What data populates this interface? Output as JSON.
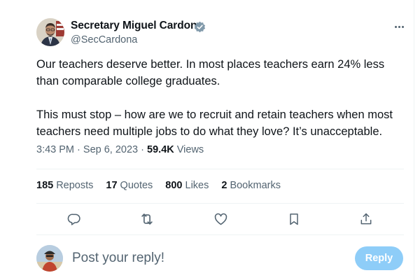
{
  "author": {
    "name": "Secretary Miguel Cardona",
    "handle": "@SecCardona",
    "verified_color": "#829aab"
  },
  "tweet": {
    "paragraphs": [
      "Our teachers deserve better. In most places teachers earn 24% less than comparable college graduates.",
      "This must stop – how are we to recruit and retain teachers when most teachers need multiple jobs to do what they love? It’s unacceptable."
    ],
    "time": "3:43 PM",
    "separator": "·",
    "date": "Sep 6, 2023",
    "views_count": "59.4K",
    "views_label": "Views"
  },
  "stats": {
    "reposts": {
      "count": "185",
      "label": "Reposts"
    },
    "quotes": {
      "count": "17",
      "label": "Quotes"
    },
    "likes": {
      "count": "800",
      "label": "Likes"
    },
    "bookmarks": {
      "count": "2",
      "label": "Bookmarks"
    }
  },
  "actions": [
    "reply-icon",
    "repost-icon",
    "like-icon",
    "bookmark-icon",
    "share-icon"
  ],
  "reply_box": {
    "placeholder": "Post your reply!",
    "button_label": "Reply",
    "button_color": "#8ecdf8"
  },
  "colors": {
    "text": "#0f1419",
    "secondary": "#536471",
    "divider": "#eff3f4"
  }
}
